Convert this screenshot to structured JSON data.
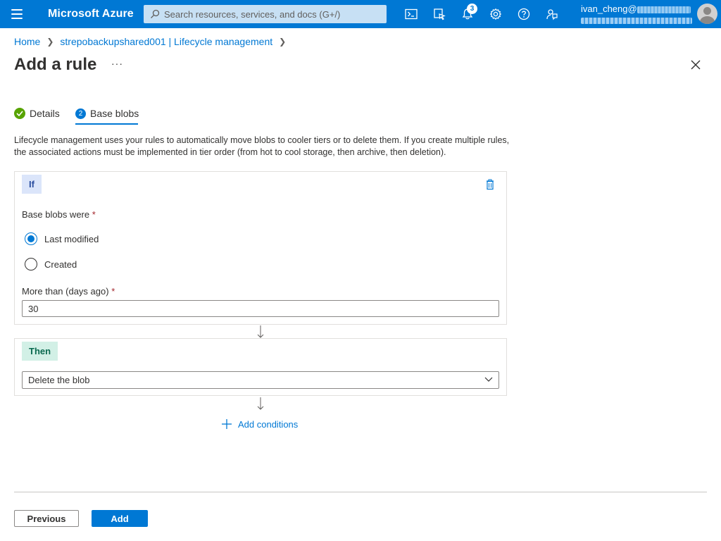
{
  "topbar": {
    "brand": "Microsoft Azure",
    "search_placeholder": "Search resources, services, and docs (G+/)",
    "notification_count": "3",
    "user_name": "ivan_cheng@"
  },
  "breadcrumb": {
    "home": "Home",
    "resource": "strepobackupshared001 | Lifecycle management"
  },
  "page": {
    "title": "Add a rule",
    "more": "···"
  },
  "tabs": [
    {
      "label": "Details",
      "step": ""
    },
    {
      "label": "Base blobs",
      "step": "2"
    }
  ],
  "description": "Lifecycle management uses your rules to automatically move blobs to cooler tiers or to delete them. If you create multiple rules, the associated actions must be implemented in tier order (from hot to cool storage, then archive, then deletion).",
  "if_block": {
    "tag": "If",
    "base_blobs_label": "Base blobs were",
    "required_mark": "*",
    "options": [
      "Last modified",
      "Created"
    ],
    "selected_option": "Last modified",
    "days_label": "More than (days ago)",
    "days_value": "30"
  },
  "then_block": {
    "tag": "Then",
    "action_selected": "Delete the blob"
  },
  "add_conditions": "Add conditions",
  "footer": {
    "previous_label": "Previous",
    "add_label": "Add"
  },
  "colors": {
    "azure_blue": "#0078d4",
    "success_green": "#57a300",
    "if_tag_bg": "#dbe5fa",
    "then_tag_bg": "#d2f0e6"
  }
}
